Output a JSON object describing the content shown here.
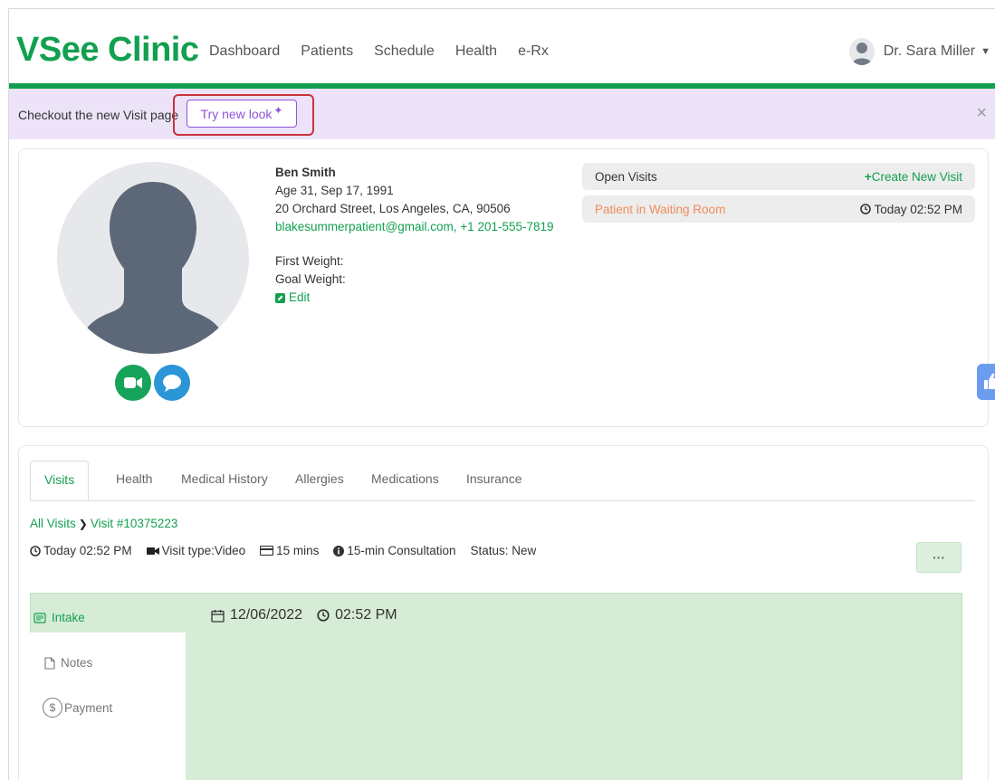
{
  "app": {
    "logo": "VSee Clinic"
  },
  "nav": {
    "items": [
      "Dashboard",
      "Patients",
      "Schedule",
      "Health",
      "e-Rx"
    ]
  },
  "user": {
    "name": "Dr. Sara Miller"
  },
  "banner": {
    "text": "Checkout the new Visit page",
    "button": "Try new look",
    "close": "×"
  },
  "patient": {
    "name": "Ben Smith",
    "age_dob": "Age 31, Sep 17, 1991",
    "address": "20 Orchard Street, Los Angeles, CA, 90506",
    "email": "blakesummerpatient@gmail.com",
    "separator": ", ",
    "phone": "+1 201-555-7819",
    "first_weight_label": "First Weight:",
    "goal_weight_label": "Goal Weight:",
    "edit_label": "Edit"
  },
  "open_visits": {
    "label": "Open Visits",
    "create_label": "Create New Visit",
    "status": "Patient in Waiting Room",
    "time": "Today 02:52 PM"
  },
  "tabs": [
    "Visits",
    "Health",
    "Medical History",
    "Allergies",
    "Medications",
    "Insurance"
  ],
  "breadcrumb": {
    "all": "All Visits",
    "current": "Visit #10375223"
  },
  "visit": {
    "time": "Today 02:52 PM",
    "type": "Visit type:Video",
    "duration": "15 mins",
    "consultation": "15-min Consultation",
    "status": "Status: New",
    "more": "···"
  },
  "side_menu": {
    "intake": "Intake",
    "notes": "Notes",
    "payment": "Payment"
  },
  "intake": {
    "date": "12/06/2022",
    "time": "02:52 PM"
  },
  "colors": {
    "brand": "#12a050",
    "banner": "#ece3f9",
    "accent_purple": "#8e55d9",
    "waiting": "#f08c5a",
    "panel": "#d7ecd6"
  }
}
